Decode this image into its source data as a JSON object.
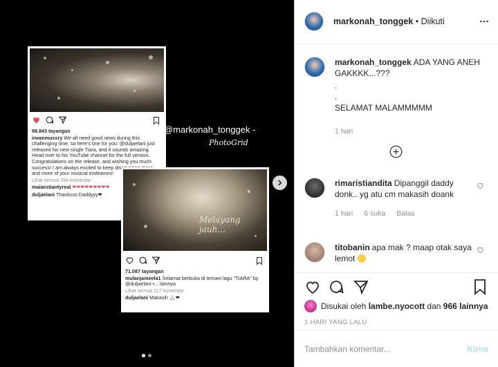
{
  "media": {
    "watermark": "- @markonah_tonggek -",
    "watermark_sub": "PhotoGrid",
    "top_card": {
      "views": "98.843 tayangan",
      "caption_user": "irwanmussry",
      "caption_text": "We all need good news during this challenging time, so here's one for you: @duljaelani just released his new single Tiara, and it sounds amazing. Head over to his YouTube channel for the full version. Congratulations on the release, and wishing you much success! I am always excited to keep discovering more and more of your musical endeavors!",
      "view_all": "Lihat semua 294 komentar",
      "comment1_user": "maiaestiantyreal",
      "comment1_text": "❤❤❤❤❤❤❤❤❤",
      "comment2_user": "duljaelani",
      "comment2_text": "Thanksss Daddyyy❤"
    },
    "bottom_card": {
      "photo_caption": "Melayang jauh...",
      "views": "71.087 tayangan",
      "caption_user": "mulanjameela1",
      "caption_text": "Selamat berbuka di temani lagu \"TIARA\" by @duljaelani •... lainnya",
      "view_all": "Lihat semua 117 komentar",
      "comment_user": "duljaelani",
      "comment_text": "Makasih 🙏🏻❤"
    }
  },
  "header": {
    "username": "markonah_tonggek",
    "follow_status": "• Diikuti"
  },
  "caption": {
    "username": "markonah_tonggek",
    "lines": [
      "ADA YANG ANEH GAKKKK...???",
      ".",
      ".",
      "SELAMAT MALAMMMMM"
    ],
    "time": "1 hari"
  },
  "comments": [
    {
      "username": "rimaristiandita",
      "text": "Dipanggil daddy donk.. yg atu cm makasih doank",
      "time": "1 hari",
      "likes": "6 suka",
      "reply": "Balas"
    },
    {
      "username": "titobanin",
      "text": "apa mak ? maap otak saya lemot"
    }
  ],
  "likes": {
    "prefix": "Disukai oleh",
    "user": "lambe.nyocott",
    "joiner": "dan",
    "others": "966 lainnya"
  },
  "time_ago": "1 HARI YANG LALU",
  "add_comment": {
    "placeholder": "Tambahkan komentar...",
    "post_label": "Kirim"
  },
  "colors": {
    "like_red": "#ed4956",
    "post_blue": "#b2dffc",
    "muted": "#8e8e8e"
  }
}
